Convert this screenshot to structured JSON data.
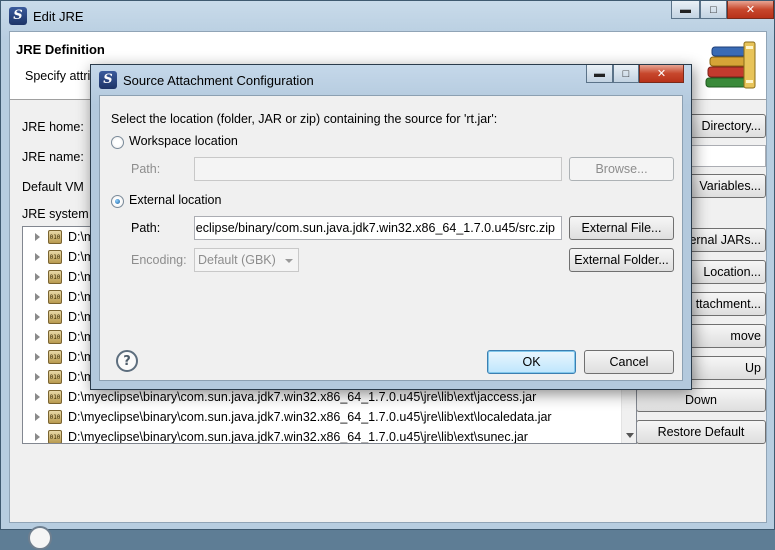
{
  "outer_window": {
    "title": "Edit JRE",
    "header_title": "JRE Definition",
    "header_desc": "Specify attri",
    "labels": {
      "jre_home": "JRE home:",
      "jre_name": "JRE name:",
      "default_vm": "Default VM",
      "jre_system": "JRE system l"
    },
    "buttons": {
      "directory": "Directory...",
      "variables": "Variables...",
      "external_jars": "ernal JARs...",
      "javadoc_location": "Location...",
      "source_attachment": "ttachment...",
      "remove": "move",
      "up": "Up",
      "down": "Down",
      "restore_default": "Restore Default"
    },
    "libraries": [
      "D:\\m",
      "D:\\m",
      "D:\\m",
      "D:\\m",
      "D:\\m",
      "D:\\m",
      "D:\\m",
      "D:\\m",
      "D:\\myeclipse\\binary\\com.sun.java.jdk7.win32.x86_64_1.7.0.u45\\jre\\lib\\ext\\jaccess.jar",
      "D:\\myeclipse\\binary\\com.sun.java.jdk7.win32.x86_64_1.7.0.u45\\jre\\lib\\ext\\localedata.jar",
      "D:\\myeclipse\\binary\\com.sun.java.jdk7.win32.x86_64_1.7.0.u45\\jre\\lib\\ext\\sunec.jar"
    ],
    "window_buttons": {
      "minimize": "▬",
      "maximize": "□",
      "close": "✕"
    }
  },
  "dialog": {
    "title": "Source Attachment Configuration",
    "prompt": "Select the location (folder, JAR or zip) containing the source for 'rt.jar':",
    "workspace_option": "Workspace location",
    "workspace_path_label": "Path:",
    "workspace_path_value": "",
    "browse_button": "Browse...",
    "external_option": "External location",
    "external_path_label": "Path:",
    "external_path_value": "eclipse/binary/com.sun.java.jdk7.win32.x86_64_1.7.0.u45/src.zip",
    "external_file_button": "External File...",
    "encoding_label": "Encoding:",
    "encoding_value": "Default (GBK)",
    "external_folder_button": "External Folder...",
    "ok_button": "OK",
    "cancel_button": "Cancel",
    "help_glyph": "?",
    "selected_option": "external",
    "window_buttons": {
      "minimize": "▬",
      "maximize": "□",
      "close": "✕"
    }
  }
}
